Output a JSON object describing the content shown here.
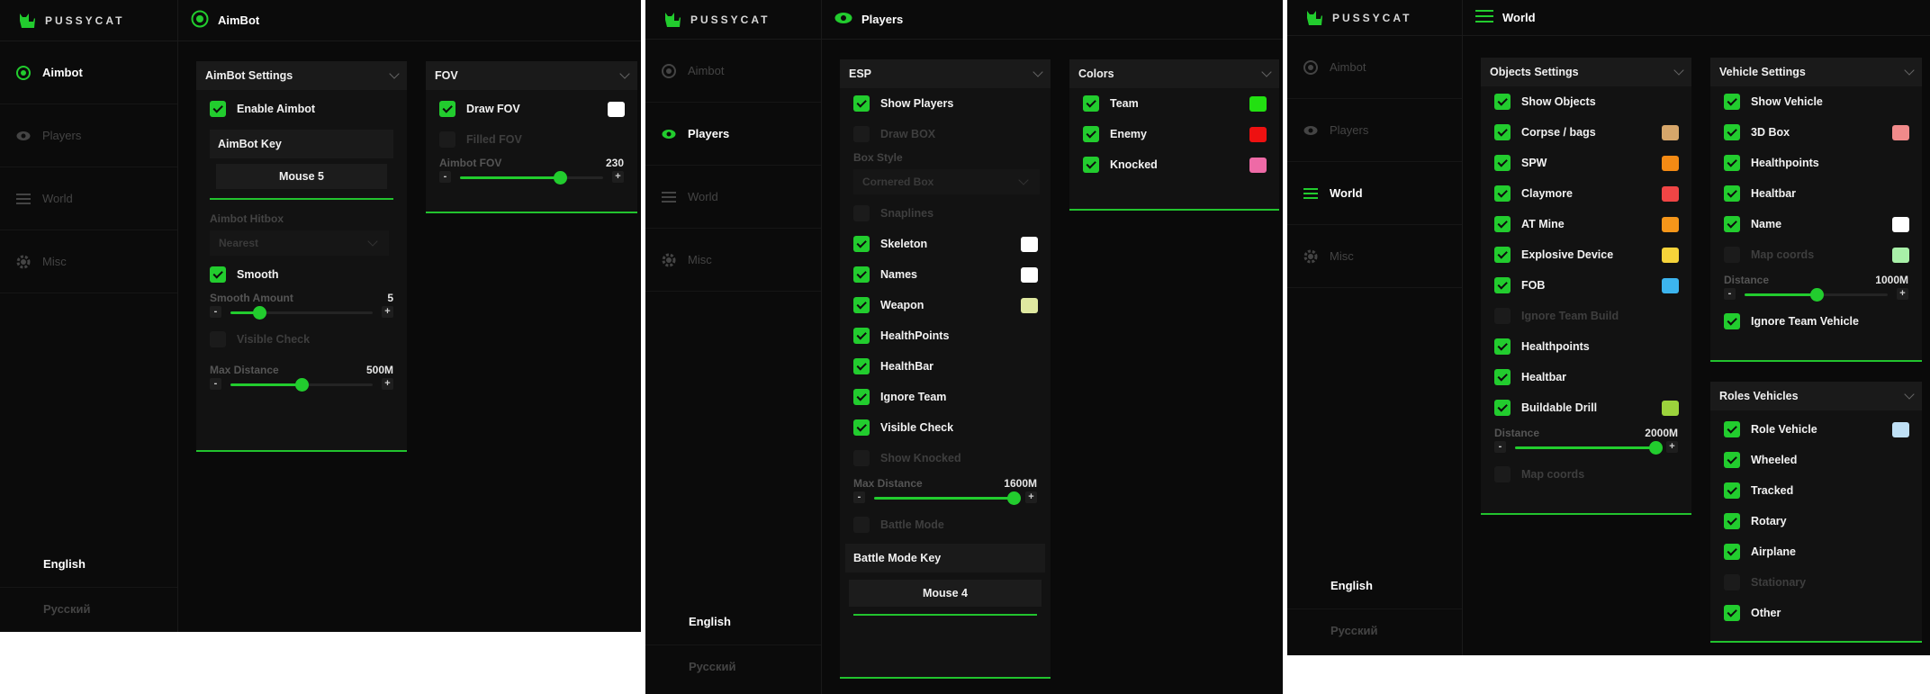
{
  "brand": "PUSSYCAT",
  "nav": {
    "aimbot": "Aimbot",
    "players": "Players",
    "world": "World",
    "misc": "Misc"
  },
  "lang": {
    "en": "English",
    "ru": "Русский"
  },
  "colors": {
    "accent": "#22cc2e",
    "bg": "#0a0a0a"
  },
  "p1": {
    "title": "AimBot",
    "settings": {
      "title": "AimBot Settings",
      "enable": "Enable Aimbot",
      "key_label": "AimBot Key",
      "key_value": "Mouse 5",
      "hitbox_label": "Aimbot Hitbox",
      "hitbox_value": "Nearest",
      "smooth": "Smooth",
      "smooth_amount_label": "Smooth Amount",
      "smooth_amount_value": "5",
      "visible_check": "Visible Check",
      "max_distance_label": "Max Distance",
      "max_distance_value": "500M"
    },
    "fov": {
      "title": "FOV",
      "draw": "Draw FOV",
      "filled": "Filled FOV",
      "aimbot_fov_label": "Aimbot FOV",
      "aimbot_fov_value": "230"
    }
  },
  "p2": {
    "title": "Players",
    "esp": {
      "title": "ESP",
      "show_players": "Show Players",
      "draw_box": "Draw BOX",
      "box_style_label": "Box Style",
      "box_style_value": "Cornered Box",
      "snaplines": "Snaplines",
      "skeleton": "Skeleton",
      "names": "Names",
      "weapon": "Weapon",
      "healthpoints": "HealthPoints",
      "healthbar": "HealthBar",
      "ignore_team": "Ignore Team",
      "visible_check": "Visible Check",
      "show_knocked": "Show Knocked",
      "max_distance_label": "Max Distance",
      "max_distance_value": "1600M",
      "battle_mode": "Battle Mode",
      "battle_key_label": "Battle Mode Key",
      "battle_key_value": "Mouse 4"
    },
    "colors": {
      "title": "Colors",
      "team": "Team",
      "enemy": "Enemy",
      "knocked": "Knocked"
    }
  },
  "p3": {
    "title": "World",
    "objects": {
      "title": "Objects Settings",
      "show_objects": "Show Objects",
      "corpse": "Corpse / bags",
      "spw": "SPW",
      "claymore": "Claymore",
      "at_mine": "AT Mine",
      "explosive": "Explosive Device",
      "fob": "FOB",
      "ignore_team_build": "Ignore Team Build",
      "healthpoints": "Healthpoints",
      "healtbar": "Healtbar",
      "buildable_drill": "Buildable Drill",
      "distance_label": "Distance",
      "distance_value": "2000M",
      "map_coords": "Map coords"
    },
    "vehicle": {
      "title": "Vehicle Settings",
      "show_vehicle": "Show Vehicle",
      "box3d": "3D Box",
      "healthpoints": "Healthpoints",
      "healtbar": "Healtbar",
      "name": "Name",
      "map_coords": "Map coords",
      "distance_label": "Distance",
      "distance_value": "1000M",
      "ignore_team_vehicle": "Ignore Team Vehicle"
    },
    "roles": {
      "title": "Roles Vehicles",
      "role_vehicle": "Role Vehicle",
      "wheeled": "Wheeled",
      "tracked": "Tracked",
      "rotary": "Rotary",
      "airplane": "Airplane",
      "stationary": "Stationary",
      "other": "Other"
    }
  },
  "swatches": {
    "white": "#ffffff",
    "weapon": "#dfe8a0",
    "team": "#22e011",
    "enemy": "#ee1111",
    "knocked": "#ee6aa6",
    "corpse": "#d6a66a",
    "spw": "#f38a14",
    "claymore": "#f04545",
    "at_mine": "#f5961a",
    "explosive": "#f5d33a",
    "fob": "#3cb4ee",
    "drill": "#9cd33c",
    "box3d": "#f08a8a",
    "map_coords": "#a8f0a8",
    "role_vehicle": "#bfe0f5"
  },
  "sliders": {
    "smooth_amount": 0.2,
    "max_distance": 0.5,
    "aimbot_fov": 0.7,
    "players_max_distance": 0.98,
    "world_distance": 0.99,
    "vehicle_distance": 0.5
  }
}
